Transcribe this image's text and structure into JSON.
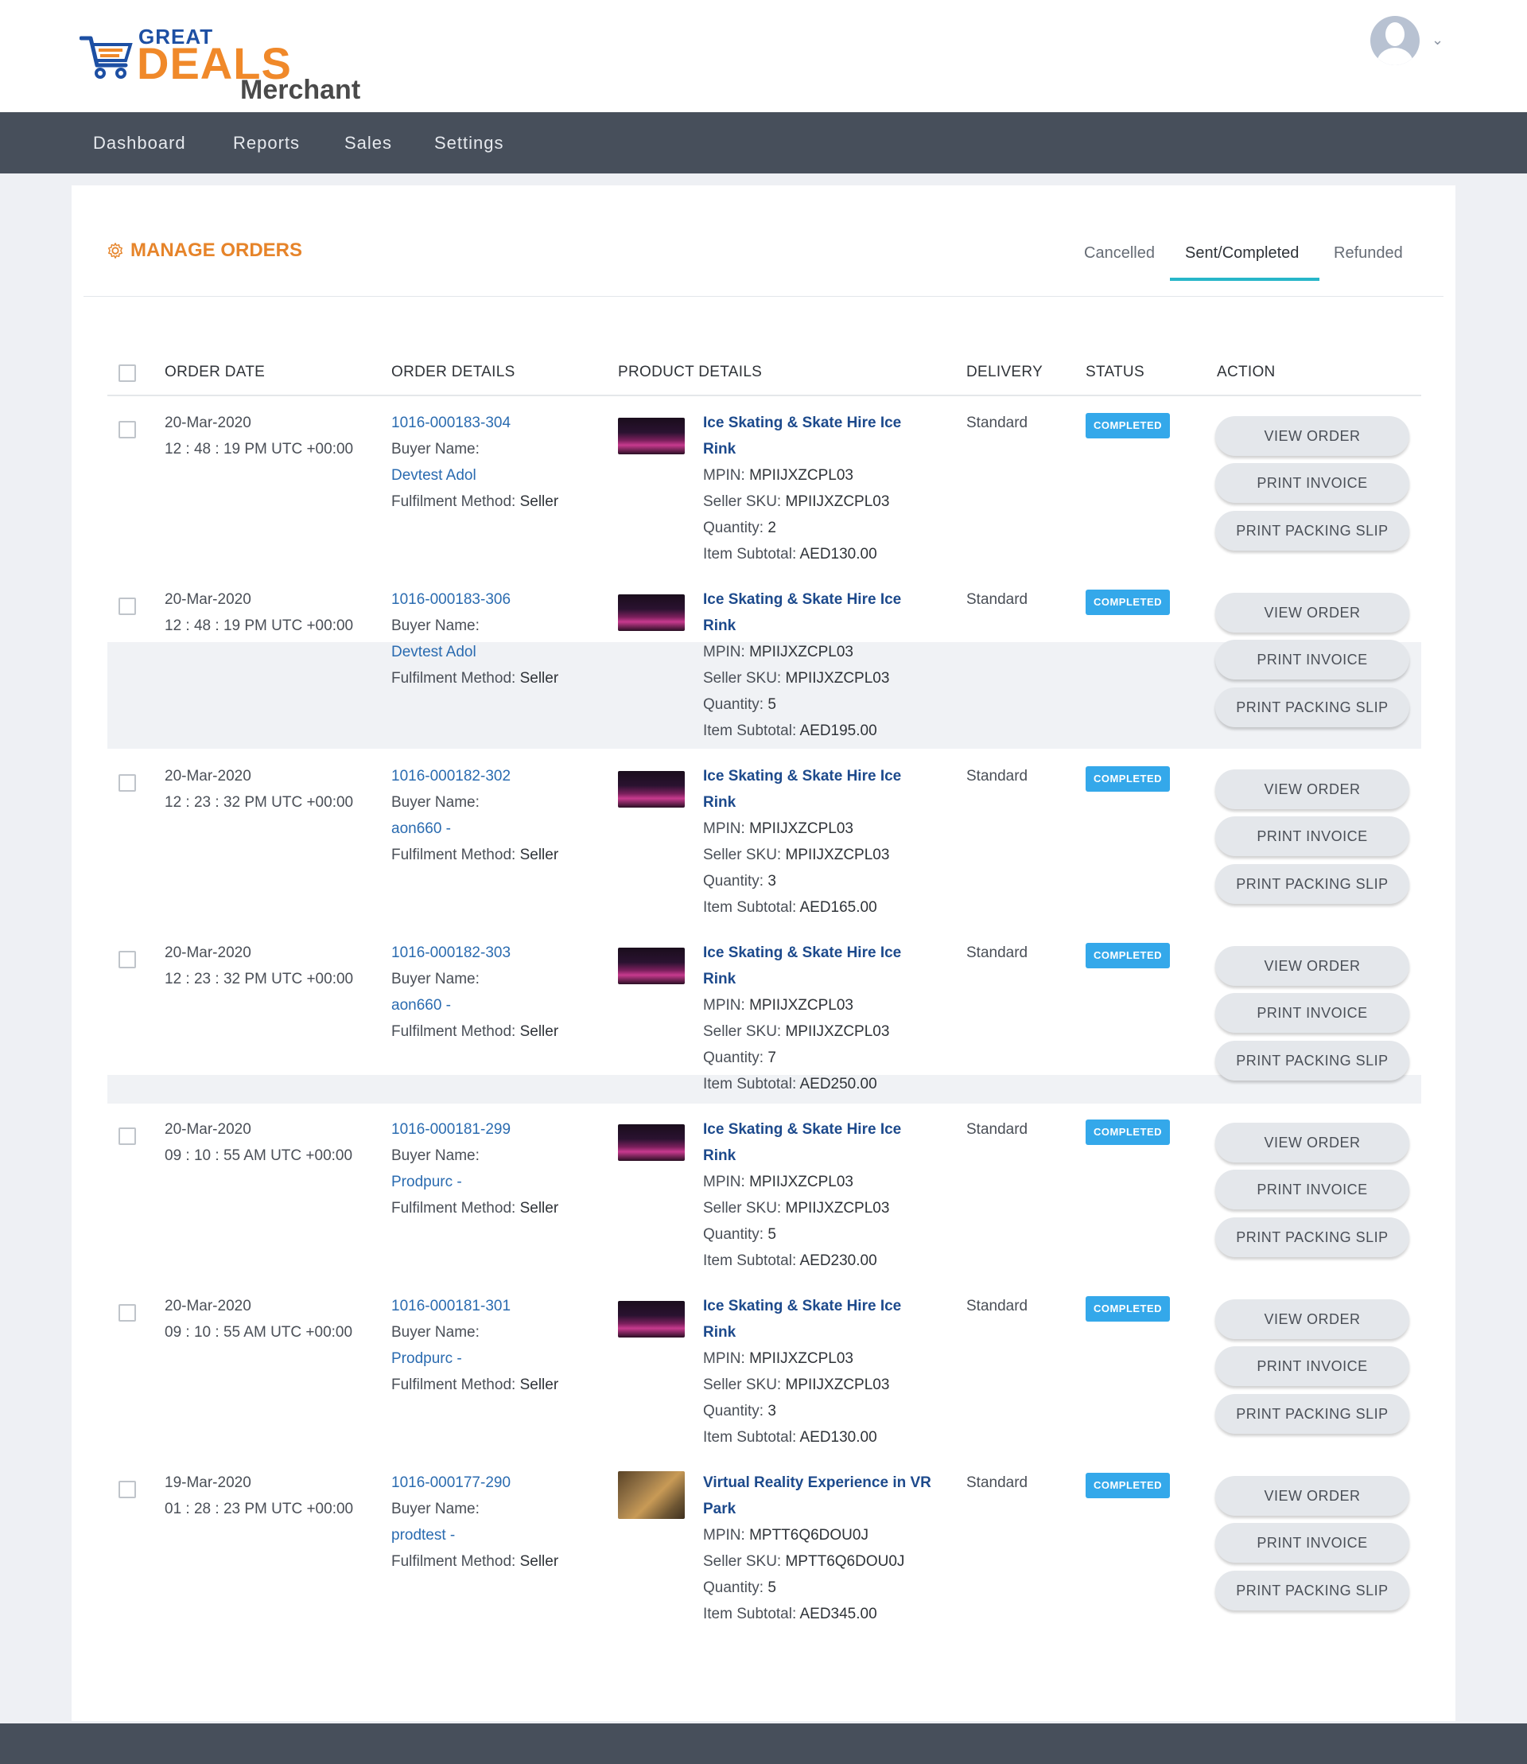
{
  "brand": {
    "great": "GREAT",
    "deals": "DEALS",
    "merchant": "Merchant"
  },
  "nav": [
    "Dashboard",
    "Reports",
    "Sales",
    "Settings"
  ],
  "page_title": "MANAGE ORDERS",
  "tabs": [
    "Cancelled",
    "Sent/Completed",
    "Refunded"
  ],
  "active_tab": "Sent/Completed",
  "columns": [
    "ORDER DATE",
    "ORDER DETAILS",
    "PRODUCT DETAILS",
    "DELIVERY",
    "STATUS",
    "ACTION"
  ],
  "labels": {
    "buyer_name": "Buyer Name:",
    "fulfilment": "Fulfilment Method:",
    "mpin": "MPIN:",
    "seller_sku": "Seller SKU:",
    "quantity": "Quantity:",
    "subtotal": "Item Subtotal:",
    "view_order": "VIEW ORDER",
    "print_invoice": "PRINT INVOICE",
    "print_packing_slip": "PRINT PACKING SLIP"
  },
  "orders": [
    {
      "date": "20-Mar-2020",
      "time": "12 : 48 : 19 PM UTC +00:00",
      "order_id": "1016-000183-304",
      "buyer": "Devtest Adol",
      "fulfilment": "Seller",
      "product_line1": "Ice Skating & Skate Hire Ice",
      "product_line2": "Rink",
      "mpin": "MPIIJXZCPL03",
      "sku": "MPIIJXZCPL03",
      "quantity": "2",
      "subtotal": "AED130.00",
      "delivery": "Standard",
      "status": "COMPLETED",
      "thumb": "ice"
    },
    {
      "date": "20-Mar-2020",
      "time": "12 : 48 : 19 PM UTC +00:00",
      "order_id": "1016-000183-306",
      "buyer": "Devtest Adol",
      "fulfilment": "Seller",
      "product_line1": "Ice Skating & Skate Hire Ice",
      "product_line2": "Rink",
      "mpin": "MPIIJXZCPL03",
      "sku": "MPIIJXZCPL03",
      "quantity": "5",
      "subtotal": "AED195.00",
      "delivery": "Standard",
      "status": "COMPLETED",
      "thumb": "ice"
    },
    {
      "date": "20-Mar-2020",
      "time": "12 : 23 : 32 PM UTC +00:00",
      "order_id": "1016-000182-302",
      "buyer": "aon660 -",
      "fulfilment": "Seller",
      "product_line1": "Ice Skating & Skate Hire Ice",
      "product_line2": "Rink",
      "mpin": "MPIIJXZCPL03",
      "sku": "MPIIJXZCPL03",
      "quantity": "3",
      "subtotal": "AED165.00",
      "delivery": "Standard",
      "status": "COMPLETED",
      "thumb": "ice"
    },
    {
      "date": "20-Mar-2020",
      "time": "12 : 23 : 32 PM UTC +00:00",
      "order_id": "1016-000182-303",
      "buyer": "aon660 -",
      "fulfilment": "Seller",
      "product_line1": "Ice Skating & Skate Hire Ice",
      "product_line2": "Rink",
      "mpin": "MPIIJXZCPL03",
      "sku": "MPIIJXZCPL03",
      "quantity": "7",
      "subtotal": "AED250.00",
      "delivery": "Standard",
      "status": "COMPLETED",
      "thumb": "ice"
    },
    {
      "date": "20-Mar-2020",
      "time": "09 : 10 : 55 AM UTC +00:00",
      "order_id": "1016-000181-299",
      "buyer": "Prodpurc -",
      "fulfilment": "Seller",
      "product_line1": "Ice Skating & Skate Hire Ice",
      "product_line2": "Rink",
      "mpin": "MPIIJXZCPL03",
      "sku": "MPIIJXZCPL03",
      "quantity": "5",
      "subtotal": "AED230.00",
      "delivery": "Standard",
      "status": "COMPLETED",
      "thumb": "ice"
    },
    {
      "date": "20-Mar-2020",
      "time": "09 : 10 : 55 AM UTC +00:00",
      "order_id": "1016-000181-301",
      "buyer": "Prodpurc -",
      "fulfilment": "Seller",
      "product_line1": "Ice Skating & Skate Hire Ice",
      "product_line2": "Rink",
      "mpin": "MPIIJXZCPL03",
      "sku": "MPIIJXZCPL03",
      "quantity": "3",
      "subtotal": "AED130.00",
      "delivery": "Standard",
      "status": "COMPLETED",
      "thumb": "ice"
    },
    {
      "date": "19-Mar-2020",
      "time": "01 : 28 : 23 PM UTC +00:00",
      "order_id": "1016-000177-290",
      "buyer": "prodtest -",
      "fulfilment": "Seller",
      "product_line1": "Virtual Reality Experience in VR",
      "product_line2": "Park",
      "mpin": "MPTT6Q6DOU0J",
      "sku": "MPTT6Q6DOU0J",
      "quantity": "5",
      "subtotal": "AED345.00",
      "delivery": "Standard",
      "status": "COMPLETED",
      "thumb": "vr"
    }
  ],
  "colors": {
    "accent": "#e6842a",
    "nav_bg": "#474f5b",
    "tab_underline": "#27b6c9",
    "badge": "#34a8ea",
    "link": "#2a6bb0"
  },
  "icons": [
    "cart-logo-icon",
    "user-avatar-icon",
    "chevron-down-icon",
    "gear-icon"
  ]
}
